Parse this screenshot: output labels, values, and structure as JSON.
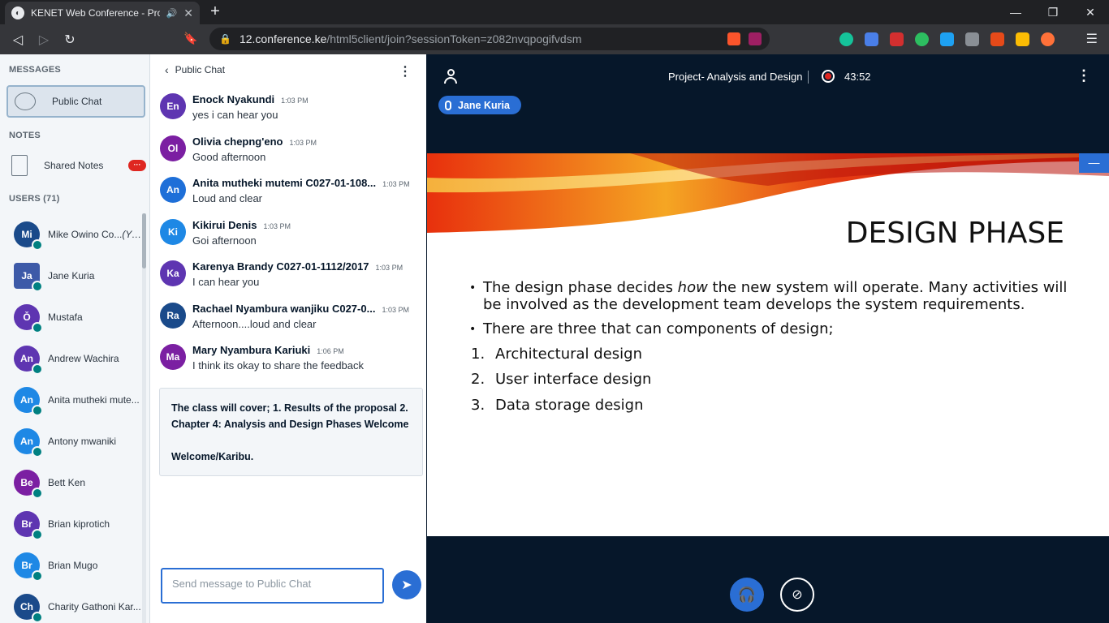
{
  "browser": {
    "tab_title": "KENET Web Conference - Proj",
    "url_host": "12.conference.ke",
    "url_path": "/html5client/join?sessionToken=z082nvqpogifvdsm"
  },
  "sidebar": {
    "messages_label": "MESSAGES",
    "public_chat_label": "Public Chat",
    "notes_label": "NOTES",
    "shared_notes_label": "Shared Notes",
    "shared_notes_badge": "···",
    "users_label": "USERS (71)",
    "users": [
      {
        "initials": "Mi",
        "name": "Mike Owino Co...",
        "suffix": "(You)",
        "color": "#1a4a8a",
        "square": false
      },
      {
        "initials": "Ja",
        "name": "Jane Kuria",
        "suffix": "",
        "color": "#3d5aa8",
        "square": true
      },
      {
        "initials": "Ǒ",
        "name": "Mustafa",
        "suffix": "",
        "color": "#5e35b1",
        "square": false
      },
      {
        "initials": "An",
        "name": "Andrew Wachira",
        "suffix": "",
        "color": "#5e35b1",
        "square": false
      },
      {
        "initials": "An",
        "name": "Anita mutheki mute...",
        "suffix": "",
        "color": "#1e88e5",
        "square": false
      },
      {
        "initials": "An",
        "name": "Antony mwaniki",
        "suffix": "",
        "color": "#1e88e5",
        "square": false
      },
      {
        "initials": "Be",
        "name": "Bett Ken",
        "suffix": "",
        "color": "#7b1fa2",
        "square": false
      },
      {
        "initials": "Br",
        "name": "Brian kiprotich",
        "suffix": "",
        "color": "#5e35b1",
        "square": false
      },
      {
        "initials": "Br",
        "name": "Brian Mugo",
        "suffix": "",
        "color": "#1e88e5",
        "square": false
      },
      {
        "initials": "Ch",
        "name": "Charity Gathoni Kar...",
        "suffix": "",
        "color": "#1a4a8a",
        "square": false
      }
    ]
  },
  "chat": {
    "header": "Public Chat",
    "messages": [
      {
        "initials": "En",
        "color": "#5e35b1",
        "name": "Enock Nyakundi",
        "time": "1:03 PM",
        "text": "yes i can hear you"
      },
      {
        "initials": "Ol",
        "color": "#7b1fa2",
        "name": "Olivia chepng'eno",
        "time": "1:03 PM",
        "text": "Good afternoon"
      },
      {
        "initials": "An",
        "color": "#1e6fd8",
        "name": "Anita mutheki mutemi C027-01-108...",
        "time": "1:03 PM",
        "text": "Loud and clear"
      },
      {
        "initials": "Ki",
        "color": "#1e88e5",
        "name": "Kikirui Denis",
        "time": "1:03 PM",
        "text": "Goi afternoon"
      },
      {
        "initials": "Ka",
        "color": "#5e35b1",
        "name": "Karenya Brandy C027-01-1112/2017",
        "time": "1:03 PM",
        "text": "I can hear you"
      },
      {
        "initials": "Ra",
        "color": "#1a4a8a",
        "name": "Rachael Nyambura wanjiku C027-0...",
        "time": "1:03 PM",
        "text": "Afternoon....loud and clear"
      },
      {
        "initials": "Ma",
        "color": "#7b1fa2",
        "name": "Mary Nyambura Kariuki",
        "time": "1:06 PM",
        "text": "I think its okay to share the feedback"
      }
    ],
    "welcome_line1": "The class will cover; 1. Results of the proposal 2.",
    "welcome_line2": "Chapter 4: Analysis and Design Phases Welcome",
    "welcome_line3": "Welcome/Karibu.",
    "input_placeholder": "Send message to Public Chat"
  },
  "presentation": {
    "meeting_title": "Project- Analysis and Design",
    "timer": "43:52",
    "talker": "Jane Kuria",
    "slide_title": "DESIGN PHASE",
    "bullet1_pre": "The design phase decides ",
    "bullet1_em": "how",
    "bullet1_post": " the new system will operate. Many activities will be involved as the development team develops the system requirements.",
    "bullet2": "There are three  that can components of design;",
    "numbered": [
      {
        "n": "1.",
        "text": "Architectural design"
      },
      {
        "n": "2.",
        "text": "User interface design"
      },
      {
        "n": "3.",
        "text": "Data storage design"
      }
    ]
  }
}
